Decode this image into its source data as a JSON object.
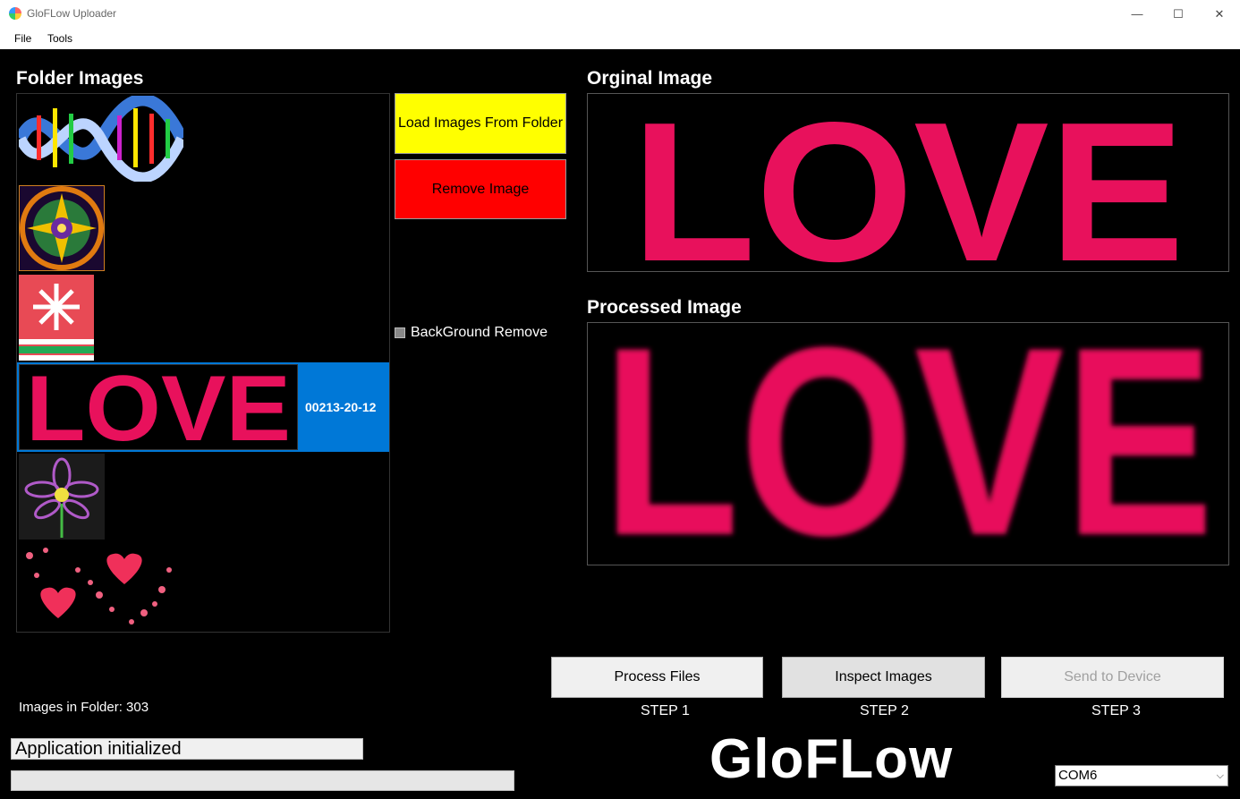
{
  "window": {
    "title": "GloFLow Uploader",
    "minimize_glyph": "—",
    "maximize_glyph": "☐",
    "close_glyph": "✕"
  },
  "menu": [
    "File",
    "Tools"
  ],
  "folder_panel": {
    "heading": "Folder Images",
    "items": [
      {
        "icon": "dna-helix-thumbnail"
      },
      {
        "icon": "kaleidoscope-thumbnail"
      },
      {
        "icon": "snowflake-sweater-thumbnail"
      },
      {
        "icon": "love-thumbnail",
        "label": "00213-20-12",
        "selected": true
      },
      {
        "icon": "flower-thumbnail"
      },
      {
        "icon": "hearts-thumbnail"
      }
    ],
    "images_count_text": "Images in Folder: 303"
  },
  "actions": {
    "load_label": "Load Images From Folder",
    "remove_label": "Remove Image",
    "background_remove_label": "BackGround Remove",
    "background_remove_checked": false
  },
  "original": {
    "heading": "Orginal Image",
    "image_text": "LOVE"
  },
  "processed": {
    "heading": "Processed Image",
    "image_text": "LOVE"
  },
  "steps": {
    "process_label": "Process Files",
    "inspect_label": "Inspect Images",
    "send_label": "Send to Device",
    "step1": "STEP 1",
    "step2": "STEP 2",
    "step3": "STEP 3"
  },
  "status_text": "Application initialized",
  "progress": 0,
  "logo_text": "GloFLow",
  "port": {
    "selected": "COM6",
    "caret": "⌵"
  },
  "colors": {
    "love_pink": "#e8115c",
    "selection_blue": "#0078d7",
    "load_yellow": "#ffff00",
    "remove_red": "#ff0000"
  }
}
